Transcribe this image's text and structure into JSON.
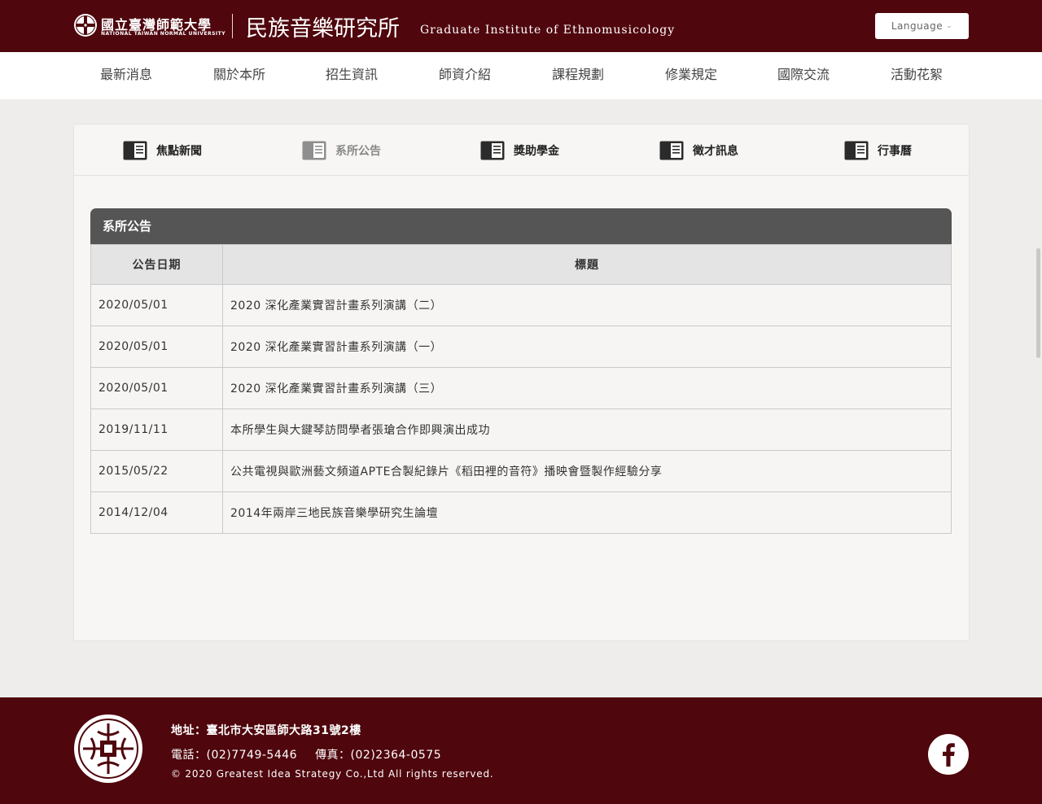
{
  "header": {
    "university_name_zh": "國立臺灣師範大學",
    "university_name_en": "NATIONAL TAIWAN NORMAL UNIVERSITY",
    "institute_name_zh": "民族音樂研究所",
    "institute_name_en": "Graduate Institute of Ethnomusicology",
    "language_button": "Language",
    "brand_color": "#4f060d"
  },
  "nav": {
    "items": [
      {
        "label": "最新消息"
      },
      {
        "label": "關於本所"
      },
      {
        "label": "招生資訊"
      },
      {
        "label": "師資介紹"
      },
      {
        "label": "課程規劃"
      },
      {
        "label": "修業規定"
      },
      {
        "label": "國際交流"
      },
      {
        "label": "活動花絮"
      }
    ]
  },
  "tabs": [
    {
      "label": "焦點新聞",
      "icon": "book-icon",
      "active": false
    },
    {
      "label": "系所公告",
      "icon": "book-icon",
      "active": true
    },
    {
      "label": "獎助學金",
      "icon": "book-icon",
      "active": false
    },
    {
      "label": "徵才訊息",
      "icon": "book-icon",
      "active": false
    },
    {
      "label": "行事曆",
      "icon": "book-icon",
      "active": false
    }
  ],
  "announcements": {
    "heading": "系所公告",
    "columns": {
      "date": "公告日期",
      "title": "標題"
    },
    "rows": [
      {
        "date": "2020/05/01",
        "title": "2020 深化產業實習計畫系列演講（二）"
      },
      {
        "date": "2020/05/01",
        "title": "2020 深化產業實習計畫系列演講（一）"
      },
      {
        "date": "2020/05/01",
        "title": "2020 深化產業實習計畫系列演講（三）"
      },
      {
        "date": "2019/11/11",
        "title": "本所學生與大鍵琴訪問學者張瑲合作即興演出成功"
      },
      {
        "date": "2015/05/22",
        "title": "公共電視與歐洲藝文頻道APTE合製紀錄片《稻田裡的音符》播映會暨製作經驗分享"
      },
      {
        "date": "2014/12/04",
        "title": "2014年兩岸三地民族音樂學研究生論壇"
      }
    ]
  },
  "footer": {
    "address": "地址：臺北市大安區師大路31號2樓",
    "phone": "電話：(02)7749-5446",
    "fax": "傳真：(02)2364-0575",
    "copyright": "© 2020 Greatest Idea Strategy Co.,Ltd All rights reserved.",
    "social_icon": "facebook-icon"
  }
}
